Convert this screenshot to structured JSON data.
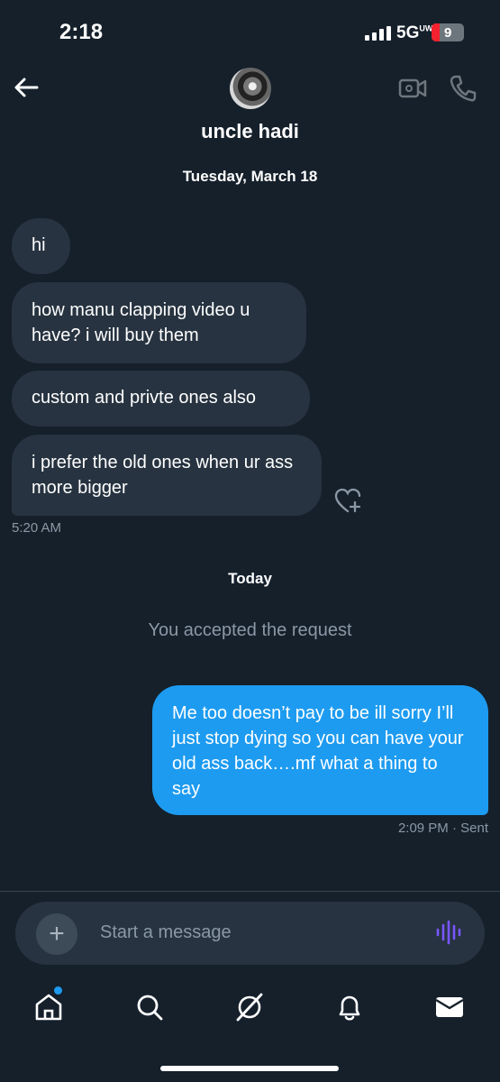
{
  "status_bar": {
    "time": "2:18",
    "network": "5G",
    "network_suffix": "UW",
    "battery": "9"
  },
  "header": {
    "contact_name": "uncle hadi"
  },
  "conversation": {
    "date_1": "Tuesday, March 18",
    "incoming": [
      {
        "text": "hi"
      },
      {
        "text": "how manu clapping video u have? i will buy them"
      },
      {
        "text": "custom and privte ones also"
      },
      {
        "text": "i prefer the old ones when  ur ass more bigger"
      }
    ],
    "incoming_time": "5:20 AM",
    "date_2": "Today",
    "system_notice": "You accepted the request",
    "outgoing": {
      "text": "Me too doesn’t pay to be ill sorry I’ll just stop dying so you can have your old ass back….mf what a thing to say"
    },
    "outgoing_meta": "2:09 PM · Sent"
  },
  "composer": {
    "placeholder": "Start a message"
  },
  "colors": {
    "background": "#15202b",
    "incoming_bubble": "#273340",
    "outgoing_bubble": "#1d9bf0",
    "voice_icon": "#7856ff"
  },
  "nav": [
    "home-icon",
    "search-icon",
    "grok-icon",
    "notifications-icon",
    "messages-icon"
  ]
}
